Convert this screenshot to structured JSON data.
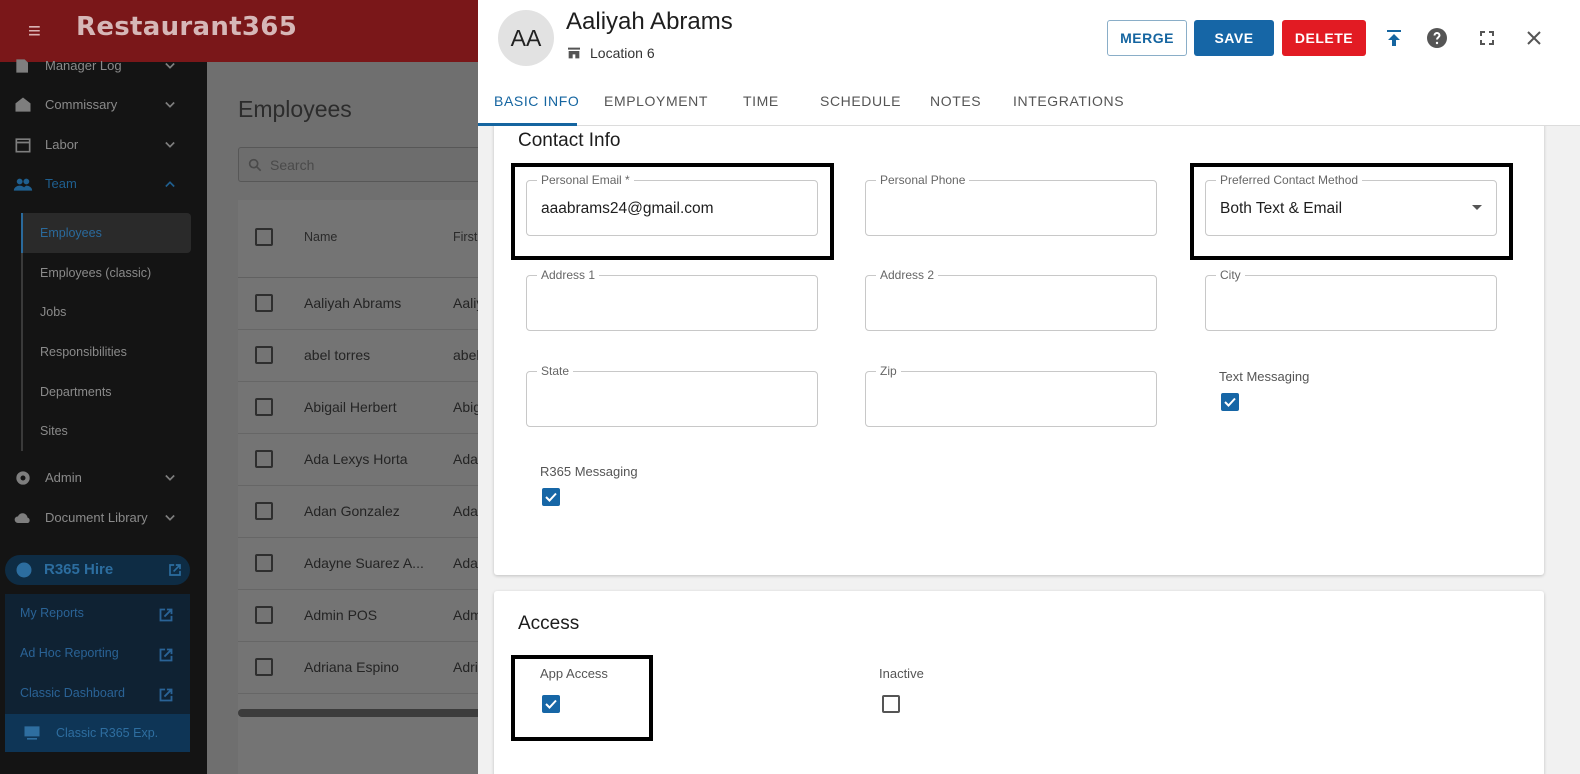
{
  "app": {
    "brand": "Restaurant365"
  },
  "sidebar": {
    "items": [
      {
        "label": "Manager Log",
        "icon": "book-icon"
      },
      {
        "label": "Commissary",
        "icon": "store-icon"
      },
      {
        "label": "Labor",
        "icon": "calendar-icon"
      },
      {
        "label": "Team",
        "icon": "people-icon",
        "expanded": true
      },
      {
        "label": "Admin",
        "icon": "gear-icon"
      },
      {
        "label": "Document Library",
        "icon": "cloud-icon"
      }
    ],
    "team_sub": [
      "Employees",
      "Employees (classic)",
      "Jobs",
      "Responsibilities",
      "Departments",
      "Sites"
    ],
    "hire": "R365 Hire",
    "reports": [
      "My Reports",
      "Ad Hoc Reporting",
      "Classic Dashboard"
    ],
    "classic": "Classic R365 Exp."
  },
  "employees_page": {
    "title": "Employees",
    "search_placeholder": "Search",
    "columns": [
      "Name",
      "First"
    ],
    "rows": [
      {
        "name": "Aaliyah Abrams",
        "first": "Aaliy"
      },
      {
        "name": "abel torres",
        "first": "abel"
      },
      {
        "name": "Abigail Herbert",
        "first": "Abig"
      },
      {
        "name": "Ada Lexys Horta",
        "first": "Ada"
      },
      {
        "name": "Adan Gonzalez",
        "first": "Ada"
      },
      {
        "name": "Adayne Suarez A...",
        "first": "Ada"
      },
      {
        "name": "Admin POS",
        "first": "Adm"
      },
      {
        "name": "Adriana Espino",
        "first": "Adri"
      }
    ]
  },
  "drawer": {
    "initials": "AA",
    "name": "Aaliyah Abrams",
    "location": "Location 6",
    "buttons": {
      "merge": "MERGE",
      "save": "SAVE",
      "delete": "DELETE"
    },
    "tabs": [
      "BASIC INFO",
      "EMPLOYMENT",
      "TIME",
      "SCHEDULE",
      "NOTES",
      "INTEGRATIONS"
    ],
    "active_tab": "BASIC INFO"
  },
  "contact": {
    "title": "Contact Info",
    "personal_email": {
      "label": "Personal Email *",
      "value": "aaabrams24@gmail.com"
    },
    "personal_phone": {
      "label": "Personal Phone",
      "value": ""
    },
    "preferred_contact": {
      "label": "Preferred Contact Method",
      "value": "Both Text & Email"
    },
    "address1": {
      "label": "Address 1",
      "value": ""
    },
    "address2": {
      "label": "Address 2",
      "value": ""
    },
    "city": {
      "label": "City",
      "value": ""
    },
    "state": {
      "label": "State",
      "value": ""
    },
    "zip": {
      "label": "Zip",
      "value": ""
    },
    "text_messaging": {
      "label": "Text Messaging",
      "checked": true
    },
    "r365_messaging": {
      "label": "R365 Messaging",
      "checked": true
    }
  },
  "access": {
    "title": "Access",
    "app_access": {
      "label": "App Access",
      "checked": true
    },
    "inactive": {
      "label": "Inactive",
      "checked": false
    }
  },
  "colors": {
    "primary": "#1666a6",
    "danger": "#e21b23",
    "brand_bar": "#7a1719"
  }
}
